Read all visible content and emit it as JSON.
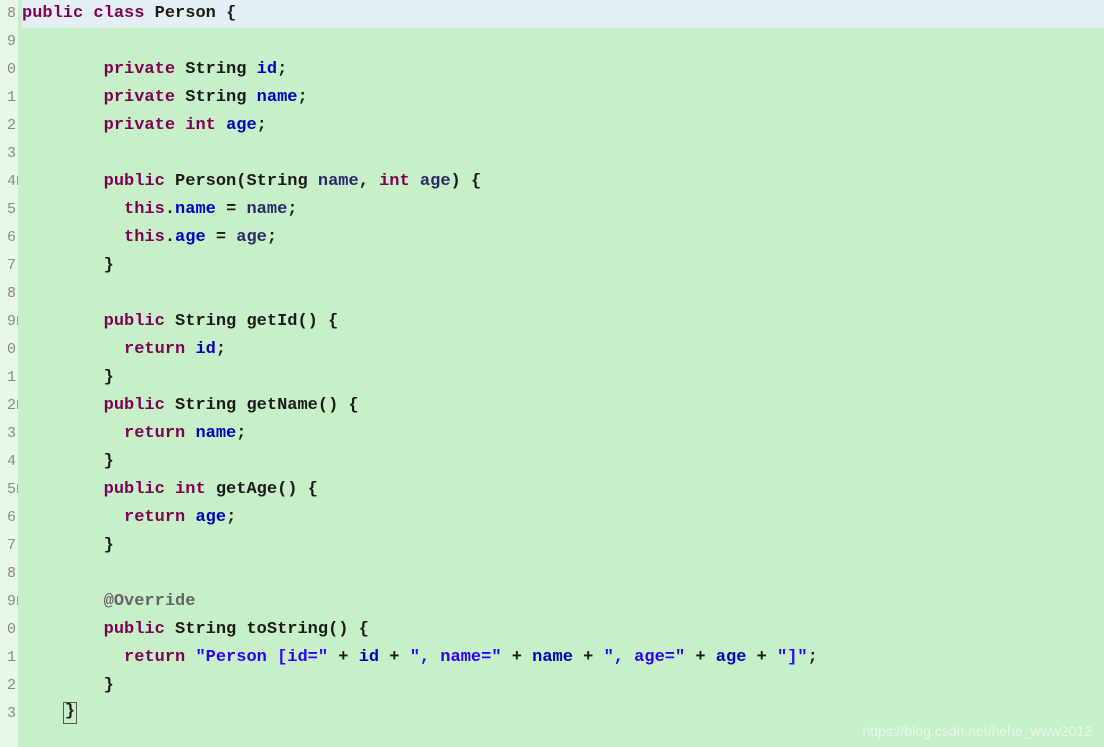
{
  "gutter": {
    "lines": [
      "8",
      "9",
      "0",
      "1",
      "2",
      "3",
      "4",
      "5",
      "6",
      "7",
      "8",
      "9",
      "0",
      "1",
      "2",
      "3",
      "4",
      "5",
      "6",
      "7",
      "8",
      "9",
      "0",
      "1",
      "2",
      "3"
    ],
    "fold_lines": [
      6,
      11,
      14,
      17,
      21
    ]
  },
  "code": {
    "l1": {
      "kw_public": "public",
      "kw_class": "class",
      "classname": "Person",
      "brace": "{"
    },
    "l3": {
      "kw_private": "private",
      "type": "String",
      "field": "id",
      "semi": ";"
    },
    "l4": {
      "kw_private": "private",
      "type": "String",
      "field": "name",
      "semi": ";"
    },
    "l5": {
      "kw_private": "private",
      "kw_int": "int",
      "field": "age",
      "semi": ";"
    },
    "l7": {
      "kw_public": "public",
      "ctor": "Person",
      "lp": "(",
      "type1": "String",
      "param1": "name",
      "comma": ",",
      "kw_int": "int",
      "param2": "age",
      "rp": ")",
      "brace": "{"
    },
    "l8": {
      "kw_this": "this",
      "dot": ".",
      "field": "name",
      "eq": "=",
      "var": "name",
      "semi": ";"
    },
    "l9": {
      "kw_this": "this",
      "dot": ".",
      "field": "age",
      "eq": "=",
      "var": "age",
      "semi": ";"
    },
    "l10": {
      "brace": "}"
    },
    "l12": {
      "kw_public": "public",
      "type": "String",
      "method": "getId",
      "parens": "()",
      "brace": "{"
    },
    "l13": {
      "kw_return": "return",
      "field": "id",
      "semi": ";"
    },
    "l14": {
      "brace": "}"
    },
    "l15": {
      "kw_public": "public",
      "type": "String",
      "method": "getName",
      "parens": "()",
      "brace": "{"
    },
    "l16": {
      "kw_return": "return",
      "field": "name",
      "semi": ";"
    },
    "l17": {
      "brace": "}"
    },
    "l18": {
      "kw_public": "public",
      "kw_int": "int",
      "method": "getAge",
      "parens": "()",
      "brace": "{"
    },
    "l19": {
      "kw_return": "return",
      "field": "age",
      "semi": ";"
    },
    "l20": {
      "brace": "}"
    },
    "l22": {
      "anno": "@Override"
    },
    "l23": {
      "kw_public": "public",
      "type": "String",
      "method": "toString",
      "parens": "()",
      "brace": "{"
    },
    "l24": {
      "kw_return": "return",
      "s1": "\"Person [id=\"",
      "plus": "+",
      "f1": "id",
      "s2": "\", name=\"",
      "f2": "name",
      "s3": "\", age=\"",
      "f3": "age",
      "s4": "\"]\"",
      "semi": ";"
    },
    "l25": {
      "brace": "}"
    },
    "l26": {
      "brace": "}"
    }
  },
  "watermark": "https://blog.csdn.net/hehe_www2012"
}
